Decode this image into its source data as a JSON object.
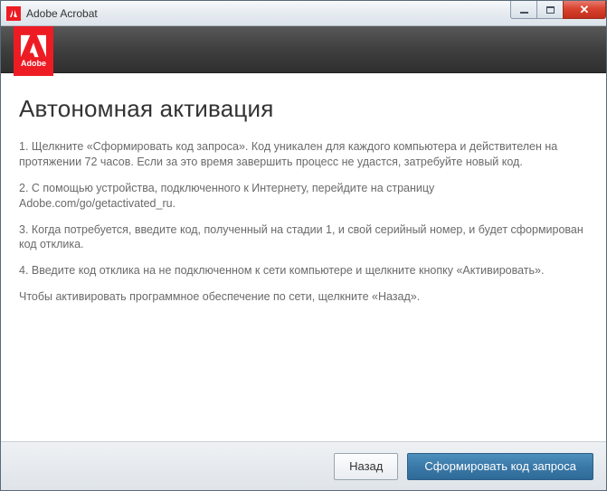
{
  "window": {
    "title": "Adobe Acrobat"
  },
  "brand": {
    "tag_text": "Adobe"
  },
  "main": {
    "heading": "Автономная активация",
    "step1": "1. Щелкните «Сформировать код запроса». Код уникален для каждого компьютера и действителен на протяжении 72 часов. Если за это время завершить процесс не удастся, затребуйте новый код.",
    "step2": "2. С помощью устройства, подключенного к Интернету, перейдите на страницу Adobe.com/go/getactivated_ru.",
    "step3": "3. Когда потребуется, введите код, полученный на стадии 1, и свой серийный номер, и будет сформирован код отклика.",
    "step4": "4. Введите код отклика на не подключенном к сети компьютере и щелкните кнопку «Активировать».",
    "note": "Чтобы активировать программное обеспечение по сети, щелкните «Назад»."
  },
  "footer": {
    "back_label": "Назад",
    "generate_label": "Сформировать код запроса"
  }
}
